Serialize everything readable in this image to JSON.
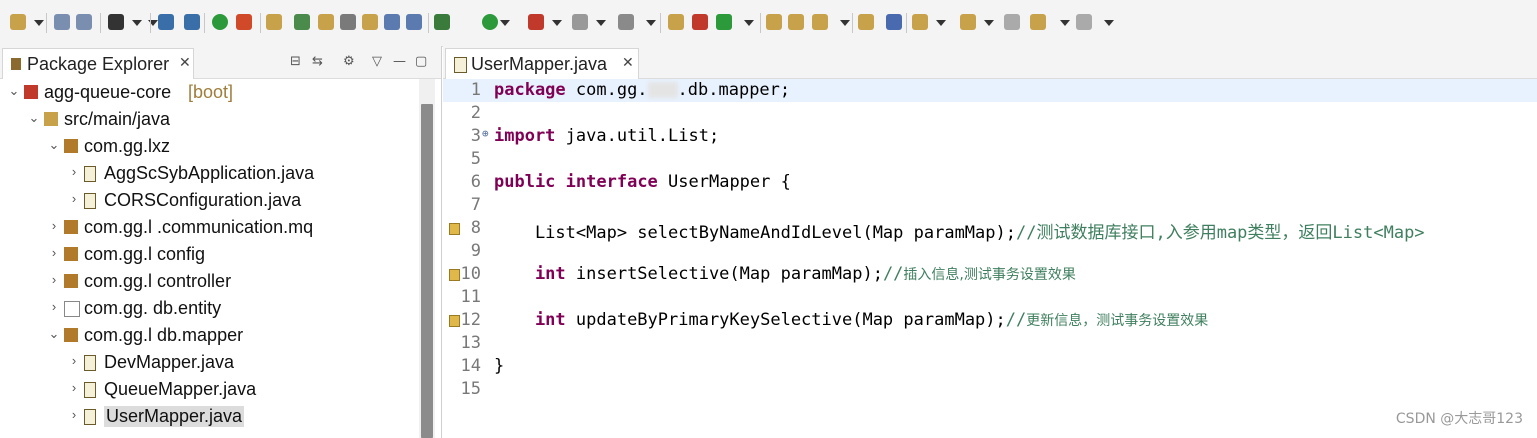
{
  "toolbar": {
    "icons": [
      "new-icon",
      "save-icon",
      "save-all-icon",
      "profile-icon",
      "terminal-icon",
      "skip-breakpoints-icon",
      "power-icon",
      "refresh-icon",
      "java-perspective-icon",
      "pin-icon",
      "edit-icon",
      "search-icon",
      "open-type-icon",
      "open-task-icon",
      "open-resource-icon",
      "debug-icon",
      "run-icon",
      "external-tools-icon",
      "stop-icon",
      "coverage-icon",
      "build-icon",
      "deploy-icon",
      "refresh-server-icon",
      "open-folder-icon",
      "open-project-icon",
      "wand-icon",
      "folder-open-icon",
      "globe-icon",
      "down-arrow-icon",
      "up-arrow-icon",
      "back-history-icon",
      "back-icon",
      "forward-icon"
    ]
  },
  "package_explorer": {
    "title": "Package Explorer",
    "close": "✕",
    "tree": [
      {
        "label": "agg-queue-core",
        "decoration": "[boot]",
        "depth": 0,
        "expanded": true,
        "icon": "project-icon"
      },
      {
        "label": "src/main/java",
        "depth": 1,
        "expanded": true,
        "icon": "source-folder-icon"
      },
      {
        "label": "com.gg.lxz",
        "depth": 2,
        "expanded": true,
        "icon": "package-icon"
      },
      {
        "label": "AggScSybApplication.java",
        "depth": 3,
        "expanded": false,
        "icon": "java-file-icon"
      },
      {
        "label": "CORSConfiguration.java",
        "depth": 3,
        "expanded": false,
        "icon": "java-file-icon"
      },
      {
        "label": "com.gg.l  .communication.mq",
        "depth": 2,
        "expanded": false,
        "icon": "package-icon"
      },
      {
        "label": "com.gg.l   config",
        "depth": 2,
        "expanded": false,
        "icon": "package-icon"
      },
      {
        "label": "com.gg.l  controller",
        "depth": 2,
        "expanded": false,
        "icon": "package-icon"
      },
      {
        "label": "com.gg.     db.entity",
        "depth": 2,
        "expanded": false,
        "icon": "empty-package-icon"
      },
      {
        "label": "com.gg.l   db.mapper",
        "depth": 2,
        "expanded": true,
        "icon": "package-icon"
      },
      {
        "label": "DevMapper.java",
        "depth": 3,
        "expanded": false,
        "icon": "java-interface-icon"
      },
      {
        "label": "QueueMapper.java",
        "depth": 3,
        "expanded": false,
        "icon": "java-interface-icon"
      },
      {
        "label": "UserMapper.java",
        "depth": 3,
        "expanded": false,
        "icon": "java-interface-icon",
        "selected": true
      }
    ]
  },
  "editor": {
    "tab_label": "UserMapper.java",
    "close": "✕",
    "lines": [
      {
        "n": "1",
        "current": true,
        "marker": false,
        "fold": false
      },
      {
        "n": "2",
        "marker": false,
        "fold": false
      },
      {
        "n": "3",
        "marker": false,
        "fold": true
      },
      {
        "n": "5",
        "marker": false,
        "fold": false
      },
      {
        "n": "6",
        "marker": false,
        "fold": false
      },
      {
        "n": "7",
        "marker": false,
        "fold": false
      },
      {
        "n": "8",
        "marker": true,
        "fold": false
      },
      {
        "n": "9",
        "marker": false,
        "fold": false
      },
      {
        "n": "10",
        "marker": true,
        "fold": false
      },
      {
        "n": "11",
        "marker": false,
        "fold": false
      },
      {
        "n": "12",
        "marker": true,
        "fold": false
      },
      {
        "n": "13",
        "marker": false,
        "fold": false
      },
      {
        "n": "14",
        "marker": false,
        "fold": false
      },
      {
        "n": "15",
        "marker": false,
        "fold": false
      }
    ],
    "code": {
      "l1_kw": "package",
      "l1_a": " com.gg.",
      "l1_b": ".db.mapper;",
      "l3_kw": "import",
      "l3_rest": " java.util.List;",
      "l6_kw1": "public",
      "l6_kw2": "interface",
      "l6_rest": " UserMapper {",
      "l8_code": "    List<Map> selectByNameAndIdLevel(Map paramMap);",
      "l8_cm1": "//测试数据库接口,入参用",
      "l8_cm2": "map",
      "l8_cm3": "类型，返回",
      "l8_cm4": "List<Map>",
      "l10_kw": "    int",
      "l10_code": " insertSelective(Map paramMap);",
      "l10_cm1": "//",
      "l10_cm2": "插入信息,测试事务设置效果",
      "l12_kw": "    int",
      "l12_code": " updateByPrimaryKeySelective(Map paramMap);",
      "l12_cm1": "//",
      "l12_cm2": "更新信息，测试事务设置效果",
      "l14_code": "}"
    }
  },
  "watermark": "CSDN @大志哥123"
}
